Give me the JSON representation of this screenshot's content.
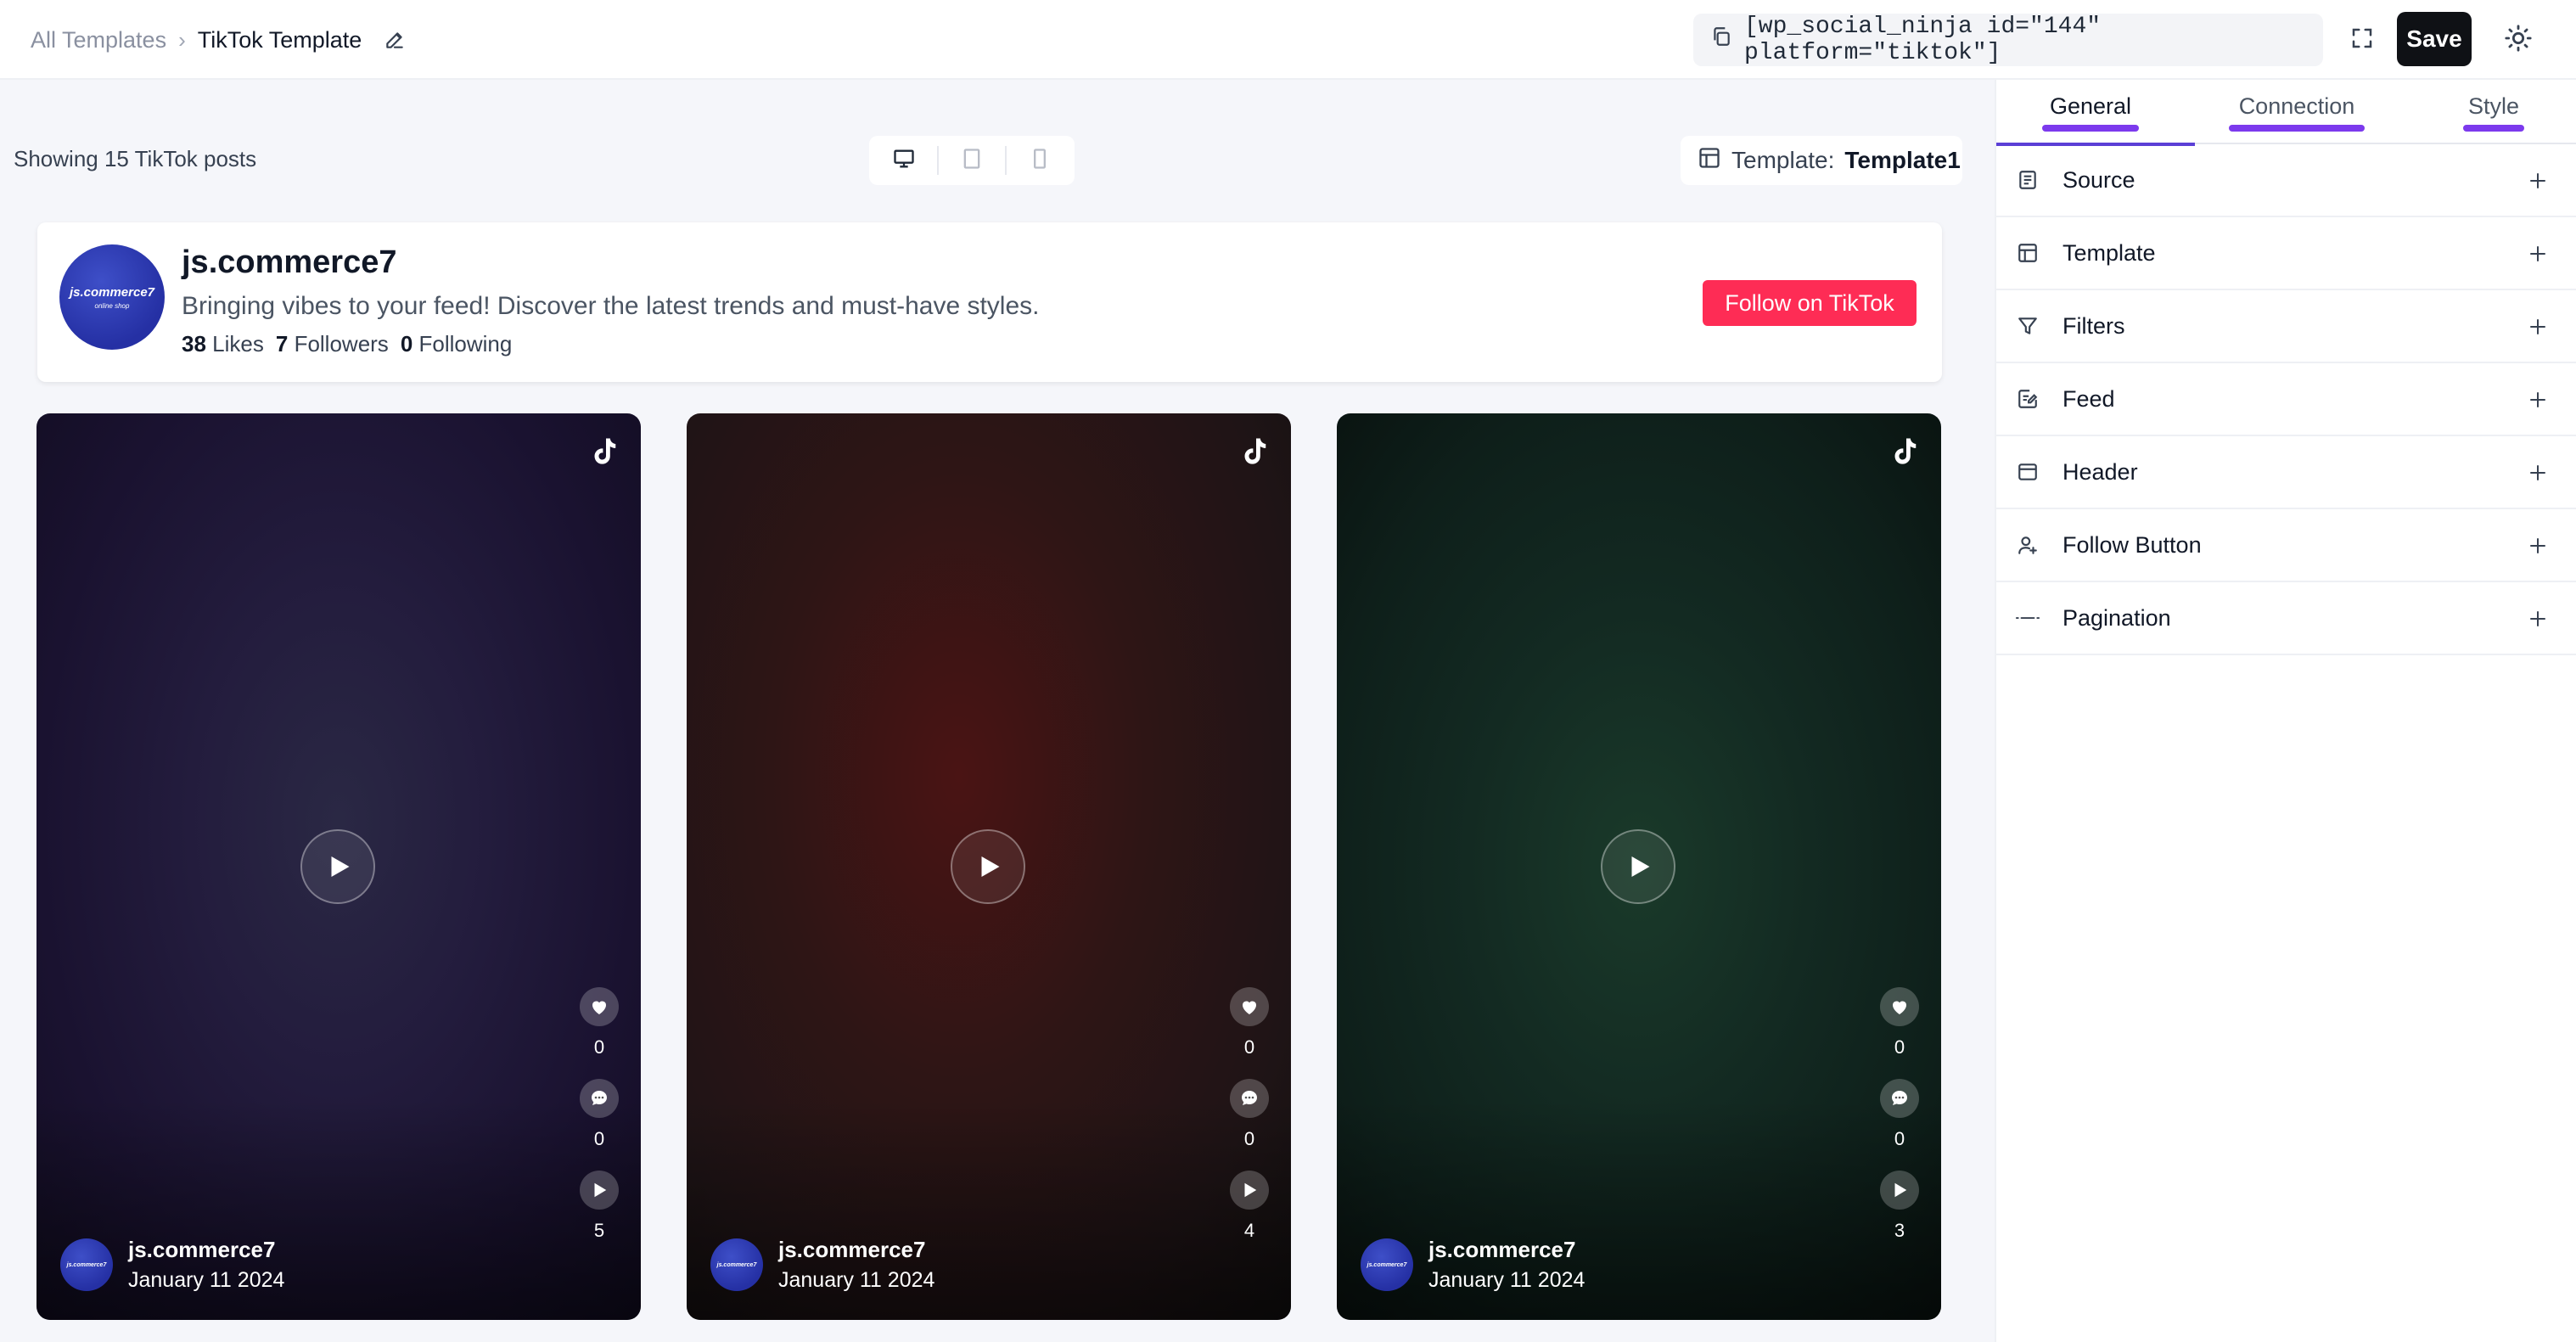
{
  "topbar": {
    "breadcrumb_root": "All Templates",
    "breadcrumb_separator": "›",
    "breadcrumb_current": "TikTok Template",
    "shortcode": "[wp_social_ninja id=\"144\" platform=\"tiktok\"]",
    "save_label": "Save"
  },
  "preview": {
    "showing_text": "Showing 15 TikTok posts",
    "template_label": "Template:",
    "template_value": "Template1",
    "devices": [
      "desktop-icon",
      "tablet-icon",
      "mobile-icon"
    ]
  },
  "profile": {
    "avatar_text": "js.commerce7",
    "avatar_subtext": "online shop",
    "name": "js.commerce7",
    "bio": "Bringing vibes to your feed! Discover the latest trends and must-have styles.",
    "likes_count": "38",
    "likes_label": "Likes",
    "followers_count": "7",
    "followers_label": "Followers",
    "following_count": "0",
    "following_label": "Following",
    "follow_button": "Follow on TikTok"
  },
  "videos": [
    {
      "author": "js.commerce7",
      "date": "January 11 2024",
      "likes": "0",
      "comments": "0",
      "plays": "5"
    },
    {
      "author": "js.commerce7",
      "date": "January 11 2024",
      "likes": "0",
      "comments": "0",
      "plays": "4"
    },
    {
      "author": "js.commerce7",
      "date": "January 11 2024",
      "likes": "0",
      "comments": "0",
      "plays": "3"
    }
  ],
  "panel": {
    "tabs": [
      "General",
      "Connection",
      "Style"
    ],
    "active_tab": "General",
    "sections": [
      {
        "label": "Source",
        "icon": "source-icon"
      },
      {
        "label": "Template",
        "icon": "template-icon"
      },
      {
        "label": "Filters",
        "icon": "filter-icon"
      },
      {
        "label": "Feed",
        "icon": "feed-icon"
      },
      {
        "label": "Header",
        "icon": "header-icon"
      },
      {
        "label": "Follow Button",
        "icon": "user-plus-icon"
      },
      {
        "label": "Pagination",
        "icon": "pagination-icon"
      }
    ]
  },
  "colors": {
    "save_button": "#0f1115",
    "follow_button": "#fe2c55",
    "tab_accent": "#7c3aed",
    "avatar_blue": "#2530a4"
  }
}
